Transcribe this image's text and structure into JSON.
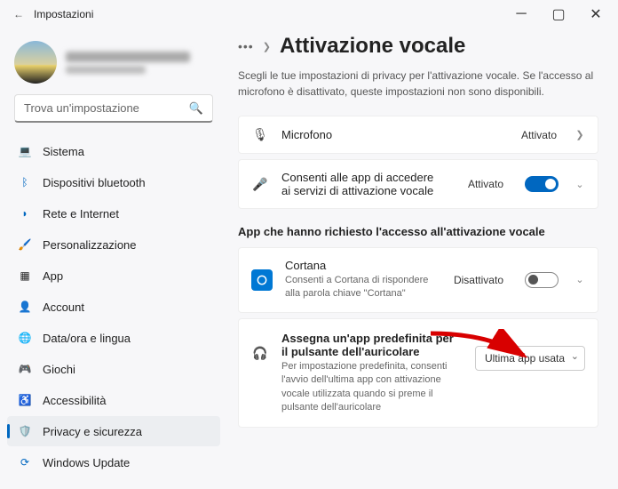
{
  "window": {
    "title": "Impostazioni"
  },
  "search": {
    "placeholder": "Trova un'impostazione"
  },
  "nav": [
    {
      "key": "sistema",
      "label": "Sistema"
    },
    {
      "key": "bluetooth",
      "label": "Dispositivi bluetooth"
    },
    {
      "key": "rete",
      "label": "Rete e Internet"
    },
    {
      "key": "personalizzazione",
      "label": "Personalizzazione"
    },
    {
      "key": "app",
      "label": "App"
    },
    {
      "key": "account",
      "label": "Account"
    },
    {
      "key": "dataora",
      "label": "Data/ora e lingua"
    },
    {
      "key": "giochi",
      "label": "Giochi"
    },
    {
      "key": "accessibilita",
      "label": "Accessibilità"
    },
    {
      "key": "privacy",
      "label": "Privacy e sicurezza"
    },
    {
      "key": "windowsupdate",
      "label": "Windows Update"
    }
  ],
  "breadcrumb": {
    "page": "Attivazione vocale"
  },
  "description": "Scegli le tue impostazioni di privacy per l'attivazione vocale. Se l'accesso al microfono è disattivato, queste impostazioni non sono disponibili.",
  "cards": {
    "mic": {
      "title": "Microfono",
      "status": "Attivato"
    },
    "allow": {
      "title": "Consenti alle app di accedere ai servizi di attivazione vocale",
      "status": "Attivato"
    }
  },
  "section": "App che hanno richiesto l'accesso all'attivazione vocale",
  "cortana": {
    "title": "Cortana",
    "sub": "Consenti a Cortana di rispondere alla parola chiave \"Cortana\"",
    "status": "Disattivato"
  },
  "headset": {
    "title": "Assegna un'app predefinita per il pulsante dell'auricolare",
    "sub": "Per impostazione predefinita, consenti l'avvio dell'ultima app con attivazione vocale utilizzata quando si preme il pulsante dell'auricolare",
    "dropdown": "Ultima app usata"
  }
}
